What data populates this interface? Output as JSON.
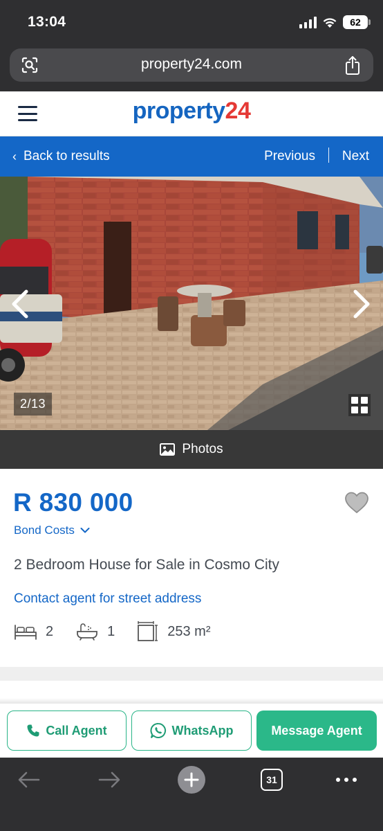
{
  "status_bar": {
    "time": "13:04",
    "battery": "62"
  },
  "browser": {
    "url": "property24.com",
    "tab_count": "31"
  },
  "header": {
    "logo_part1": "property",
    "logo_part2": "24"
  },
  "nav": {
    "back_label": "Back to results",
    "previous_label": "Previous",
    "next_label": "Next"
  },
  "gallery": {
    "counter": "2/13",
    "photos_label": "Photos"
  },
  "listing": {
    "price": "R 830 000",
    "bond_costs_label": "Bond Costs",
    "title": "2 Bedroom House for Sale in Cosmo City",
    "address_link": "Contact agent for street address",
    "bedrooms": "2",
    "bathrooms": "1",
    "floor_area": "253 m²"
  },
  "actions": {
    "call_label": "Call Agent",
    "whatsapp_label": "WhatsApp",
    "message_label": "Message Agent"
  },
  "colors": {
    "brand_blue": "#1467c7",
    "brand_red": "#e53935",
    "action_green": "#2bb889"
  }
}
